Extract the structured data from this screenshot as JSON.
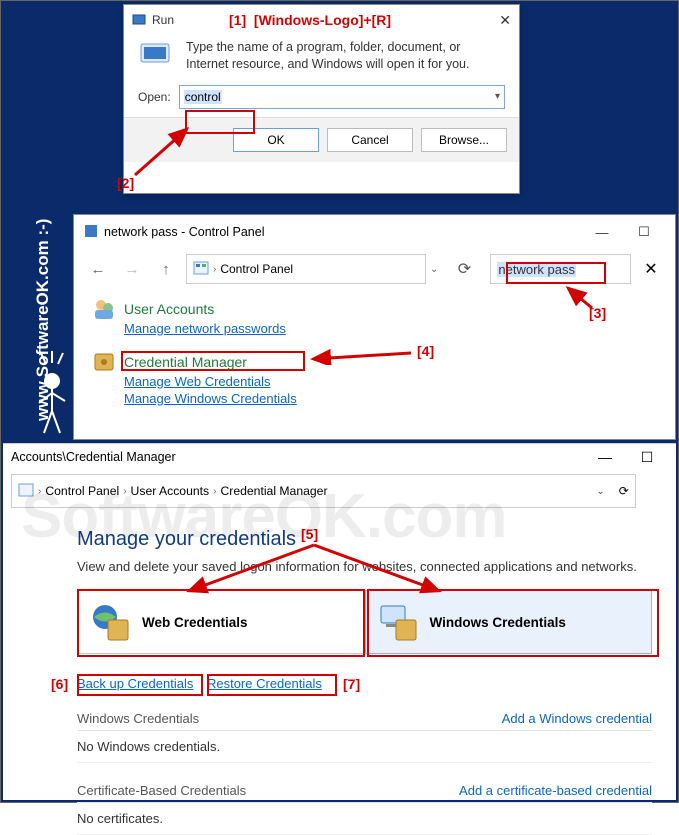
{
  "watermark": {
    "url": "www.SoftwareOK.com :-)"
  },
  "run": {
    "title": "Run",
    "description": "Type the name of a program, folder, document, or Internet resource, and Windows will open it for you.",
    "open_label": "Open:",
    "open_value": "control",
    "ok": "OK",
    "cancel": "Cancel",
    "browse": "Browse..."
  },
  "annotations": {
    "shortcut": "[Windows-Logo]+[R]",
    "n1": "[1]",
    "n2": "[2]",
    "n3": "[3]",
    "n4": "[4]",
    "n5": "[5]",
    "n6": "[6]",
    "n7": "[7]"
  },
  "cp_search": {
    "title": "network pass - Control Panel",
    "breadcrumb_root": "Control Panel",
    "search_value": "network pass",
    "results": {
      "user_accounts": "User Accounts",
      "manage_net_pass": "Manage network passwords",
      "cred_mgr": "Credential Manager",
      "manage_web": "Manage Web Credentials",
      "manage_win": "Manage Windows Credentials"
    }
  },
  "cred_mgr": {
    "title_tail": "Accounts\\Credential Manager",
    "crumbs": {
      "root": "Control Panel",
      "ua": "User Accounts",
      "cm": "Credential Manager"
    },
    "heading": "Manage your credentials",
    "sub": "View and delete your saved logon information for websites, connected applications and networks.",
    "card_web": "Web Credentials",
    "card_win": "Windows Credentials",
    "backup": "Back up Credentials",
    "restore": "Restore Credentials",
    "sec1": {
      "hdr": "Windows Credentials",
      "add": "Add a Windows credential",
      "empty": "No Windows credentials."
    },
    "sec2": {
      "hdr": "Certificate-Based Credentials",
      "add": "Add a certificate-based credential",
      "empty": "No certificates."
    }
  }
}
